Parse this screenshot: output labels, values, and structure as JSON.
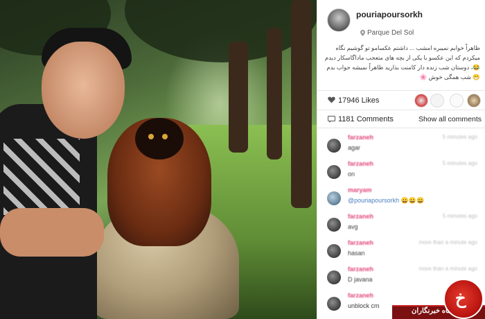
{
  "post": {
    "username": "pouriapoursorkh",
    "location": "Parque Del Sol",
    "caption": "ظاهراً خوابم نمیبره امشب ... داشتم عکسامو تو گوشیم نگاه میکردم که این عکسو با یکی از بچه های متعجب ماداگاسکار دیدم 😂، دوستان شب زنده دار کامنت بذارید ظاهراً نمیشه جواب بدم 😁 شب همگی خوش 🌸",
    "likes_label": "17946 Likes",
    "comments_label": "1181 Comments",
    "show_all_label": "Show all comments"
  },
  "comments": [
    {
      "user": "farzaneh",
      "time": "5 minutes ago",
      "text": "agar",
      "style": "blurred"
    },
    {
      "user": "farzaneh",
      "time": "5 minutes ago",
      "text": "on",
      "style": "blurred"
    },
    {
      "user": "maryam",
      "time": "5 minutes ago",
      "text": "@pouriapoursorkh 😀😀😀",
      "style": "mention"
    },
    {
      "user": "farzaneh",
      "time": "5 minutes ago",
      "text": "avg",
      "style": "blurred"
    },
    {
      "user": "farzaneh",
      "time": "more than a minute ago",
      "text": "hasan",
      "style": "blurred"
    },
    {
      "user": "farzaneh",
      "time": "more than a minute ago",
      "text": "D javana",
      "style": "blurred"
    },
    {
      "user": "farzaneh",
      "time": "",
      "text": "unblock cm",
      "style": "plain"
    }
  ],
  "watermark": {
    "text": "باشگاه خبرنگاران",
    "logo_mark": "خ",
    "color": "#b8120f"
  },
  "icons": {
    "location": "pin-icon",
    "likes": "heart-icon",
    "comments": "comment-icon"
  }
}
